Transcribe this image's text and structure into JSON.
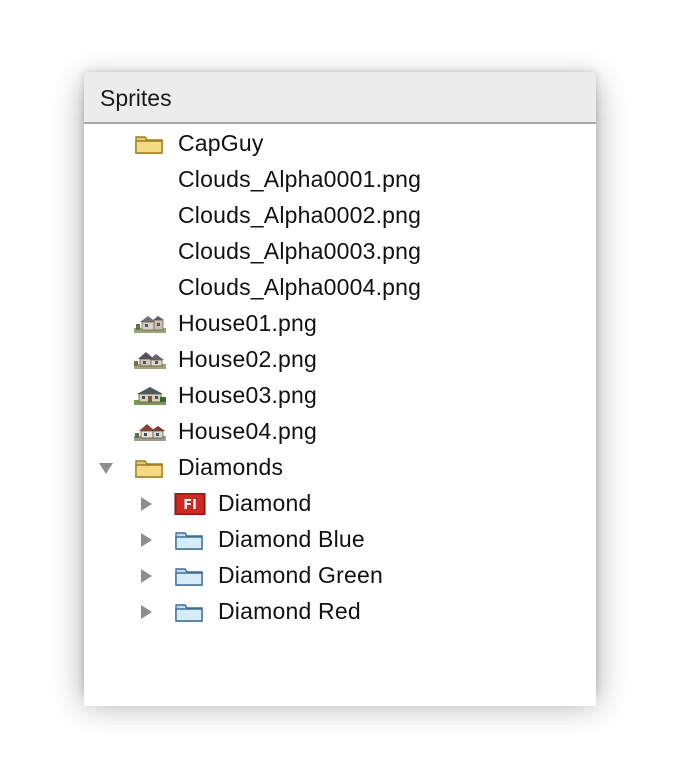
{
  "panel": {
    "title": "Sprites"
  },
  "tree": {
    "items": [
      {
        "label": "CapGuy",
        "icon": "folder-icon"
      },
      {
        "label": "Clouds_Alpha0001.png",
        "icon": ""
      },
      {
        "label": "Clouds_Alpha0002.png",
        "icon": ""
      },
      {
        "label": "Clouds_Alpha0003.png",
        "icon": ""
      },
      {
        "label": "Clouds_Alpha0004.png",
        "icon": ""
      },
      {
        "label": "House01.png",
        "icon": "house-thumbnail-icon"
      },
      {
        "label": "House02.png",
        "icon": "house-thumbnail-icon"
      },
      {
        "label": "House03.png",
        "icon": "house-thumbnail-icon"
      },
      {
        "label": "House04.png",
        "icon": "house-thumbnail-icon"
      },
      {
        "label": "Diamonds",
        "icon": "folder-icon",
        "expanded": true
      },
      {
        "label": "Diamond",
        "icon": "flash-fl-icon",
        "expanded": false
      },
      {
        "label": "Diamond Blue",
        "icon": "blue-folder-icon",
        "expanded": false
      },
      {
        "label": "Diamond Green",
        "icon": "blue-folder-icon",
        "expanded": false
      },
      {
        "label": "Diamond Red",
        "icon": "blue-folder-icon",
        "expanded": false
      }
    ]
  },
  "colors": {
    "yellow_folder": "#f3d27a",
    "blue_folder": "#cde6f5",
    "flash_icon": "#c4241c",
    "header_bg": "#ececec"
  }
}
